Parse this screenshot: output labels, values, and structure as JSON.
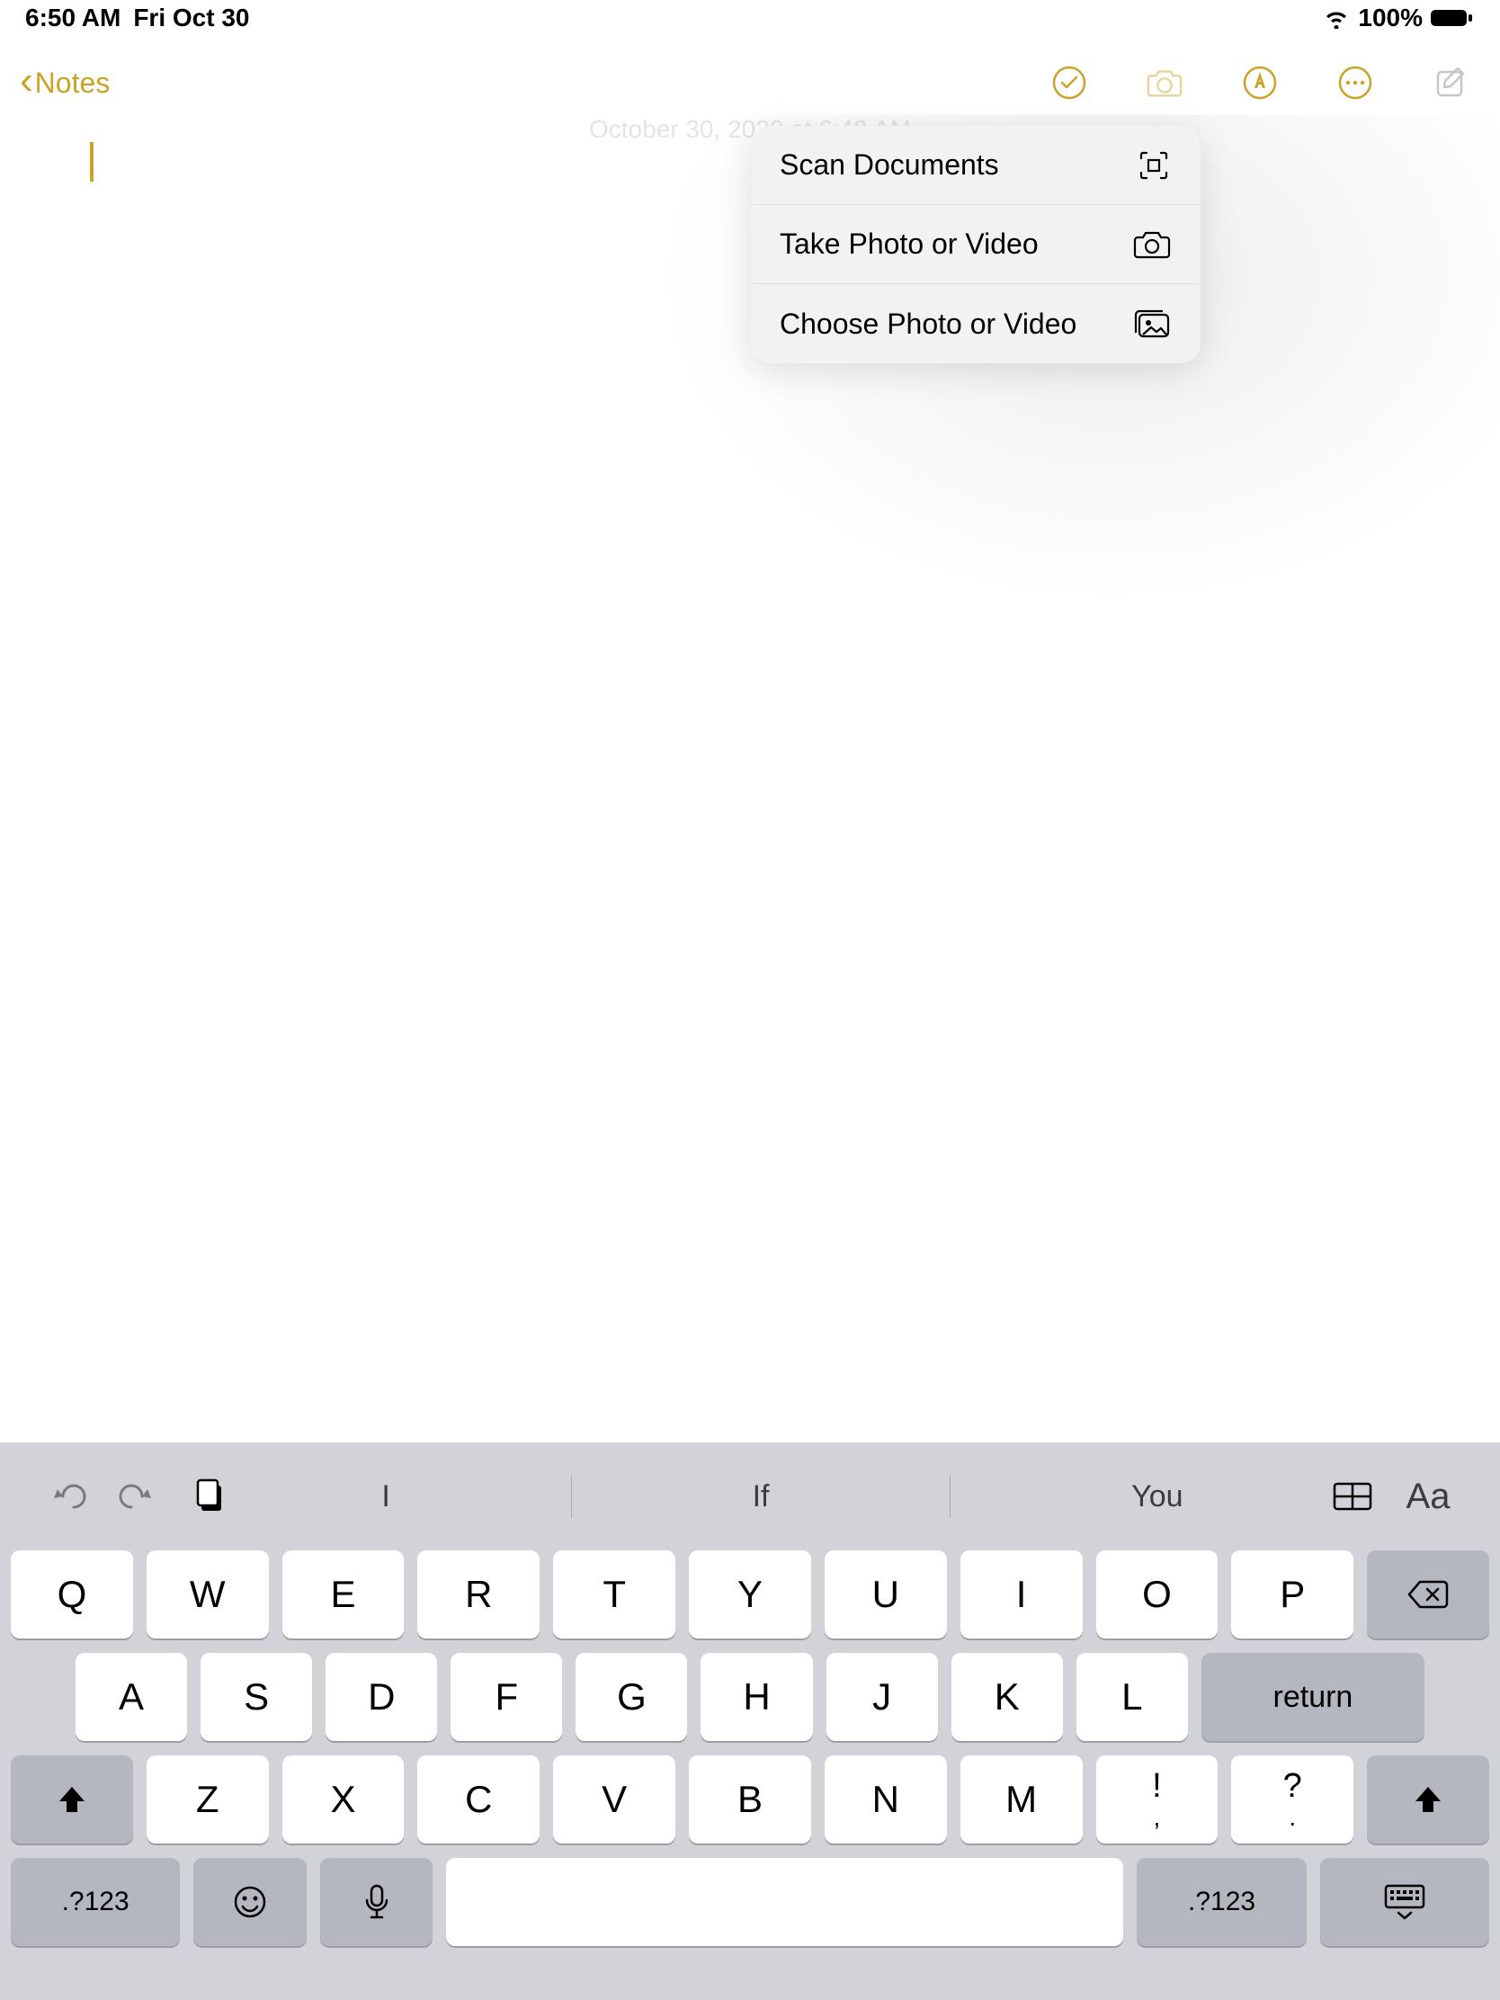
{
  "status": {
    "time": "6:50 AM",
    "date": "Fri Oct 30",
    "battery": "100%"
  },
  "nav": {
    "back_label": "Notes"
  },
  "note": {
    "timestamp": "October 30, 2020 at 6:49 AM"
  },
  "popover": {
    "items": [
      {
        "label": "Scan Documents",
        "icon": "scan"
      },
      {
        "label": "Take Photo or Video",
        "icon": "camera"
      },
      {
        "label": "Choose Photo or Video",
        "icon": "gallery"
      }
    ]
  },
  "keyboard": {
    "suggestions": [
      "I",
      "If",
      "You"
    ],
    "row1": [
      "Q",
      "W",
      "E",
      "R",
      "T",
      "Y",
      "U",
      "I",
      "O",
      "P"
    ],
    "row2": [
      "A",
      "S",
      "D",
      "F",
      "G",
      "H",
      "J",
      "K",
      "L"
    ],
    "row3": [
      "Z",
      "X",
      "C",
      "V",
      "B",
      "N",
      "M"
    ],
    "punct1_top": "!",
    "punct1_bot": ",",
    "punct2_top": "?",
    "punct2_bot": ".",
    "numkey": ".?123",
    "return": "return",
    "aa": "Aa"
  }
}
